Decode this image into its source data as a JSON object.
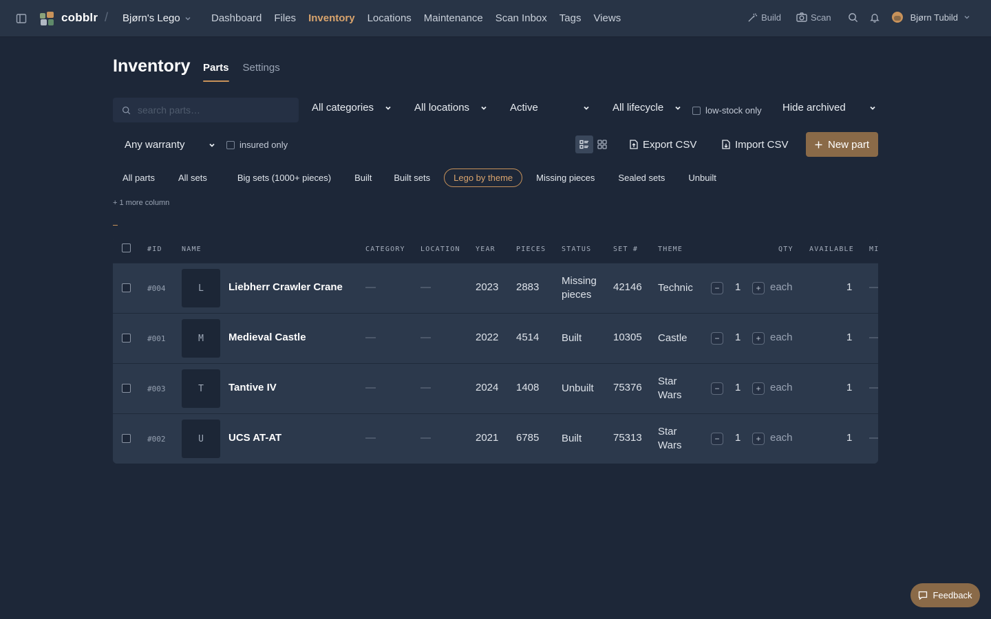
{
  "app": {
    "brand": "cobblr",
    "workspace": "Bjørn's Lego",
    "nav": [
      "Dashboard",
      "Files",
      "Inventory",
      "Locations",
      "Maintenance",
      "Scan Inbox",
      "Tags",
      "Views"
    ],
    "active_nav": "Inventory",
    "actions": {
      "build": "Build",
      "scan": "Scan"
    },
    "user": "Bjørn Tubild",
    "accent": "#d9a46d",
    "icons": [
      "sidebar-icon",
      "logo-icon",
      "wand-icon",
      "camera-icon",
      "search-icon",
      "bell-icon",
      "avatar-icon",
      "chevron-down-icon"
    ]
  },
  "page": {
    "title": "Inventory",
    "tabs": [
      "Parts",
      "Settings"
    ]
  },
  "filters": {
    "search_placeholder": "search parts…",
    "category": "All categories",
    "location": "All locations",
    "status": "Active",
    "lifecycle": "All lifecycle",
    "low_stock": "low-stock only",
    "archived": "Hide archived",
    "warranty": "Any warranty",
    "insured": "insured only"
  },
  "toolbar": {
    "export": "Export CSV",
    "import": "Import CSV",
    "new_part": "New part"
  },
  "saved_views": [
    "All parts",
    "All sets",
    "Big sets (1000+ pieces)",
    "Built",
    "Built sets",
    "Lego by theme",
    "Missing pieces",
    "Sealed sets",
    "Unbuilt"
  ],
  "active_view": "Lego by theme",
  "more_columns": "+ 1 more column",
  "table": {
    "columns": [
      "#ID",
      "NAME",
      "CATEGORY",
      "LOCATION",
      "YEAR",
      "PIECES",
      "STATUS",
      "SET #",
      "THEME",
      "QTY",
      "AVAILABLE",
      "MI"
    ],
    "rows": [
      {
        "id": "#004",
        "initial": "L",
        "name": "Liebherr Crawler Crane",
        "category": "—",
        "location": "—",
        "year": "2023",
        "pieces": "2883",
        "status": [
          "Missing",
          "pieces"
        ],
        "set": "42146",
        "theme": [
          "Technic",
          ""
        ],
        "qty": "1",
        "unit": "each",
        "available": "1",
        "mi": "—"
      },
      {
        "id": "#001",
        "initial": "M",
        "name": "Medieval Castle",
        "category": "—",
        "location": "—",
        "year": "2022",
        "pieces": "4514",
        "status": [
          "Built",
          ""
        ],
        "set": "10305",
        "theme": [
          "Castle",
          ""
        ],
        "qty": "1",
        "unit": "each",
        "available": "1",
        "mi": "—"
      },
      {
        "id": "#003",
        "initial": "T",
        "name": "Tantive IV",
        "category": "—",
        "location": "—",
        "year": "2024",
        "pieces": "1408",
        "status": [
          "Unbuilt",
          ""
        ],
        "set": "75376",
        "theme": [
          "Star",
          "Wars"
        ],
        "qty": "1",
        "unit": "each",
        "available": "1",
        "mi": "—"
      },
      {
        "id": "#002",
        "initial": "U",
        "name": "UCS AT-AT",
        "category": "—",
        "location": "—",
        "year": "2021",
        "pieces": "6785",
        "status": [
          "Built",
          ""
        ],
        "set": "75313",
        "theme": [
          "Star",
          "Wars"
        ],
        "qty": "1",
        "unit": "each",
        "available": "1",
        "mi": "—"
      }
    ]
  },
  "feedback": "Feedback"
}
